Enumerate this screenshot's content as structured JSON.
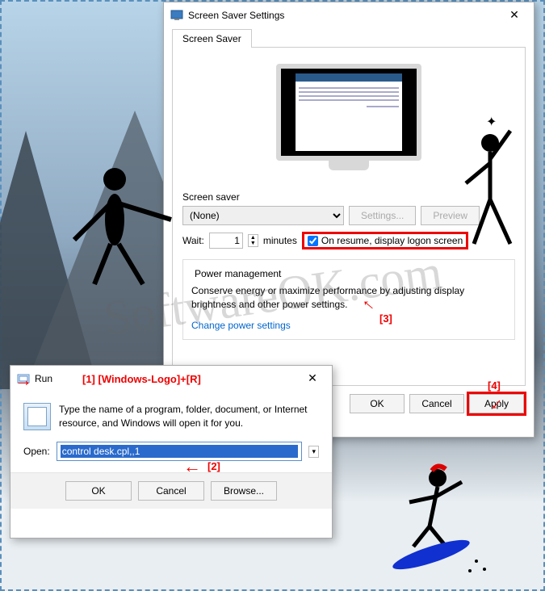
{
  "watermark": "SoftwareOK.com",
  "screensaver_dialog": {
    "title": "Screen Saver Settings",
    "tab": "Screen Saver",
    "group_label": "Screen saver",
    "saver_selected": "(None)",
    "settings_btn": "Settings...",
    "preview_btn": "Preview",
    "wait_label": "Wait:",
    "wait_value": "1",
    "minutes_label": "minutes",
    "resume_label": "On resume, display logon screen",
    "power_legend": "Power management",
    "power_text": "Conserve energy or maximize performance by adjusting display brightness and other power settings.",
    "power_link": "Change power settings",
    "ok": "OK",
    "cancel": "Cancel",
    "apply": "Apply"
  },
  "run_dialog": {
    "title": "Run",
    "description": "Type the name of a program, folder, document, or Internet resource, and Windows will open it for you.",
    "open_label": "Open:",
    "open_value": "control desk.cpl,,1",
    "ok": "OK",
    "cancel": "Cancel",
    "browse": "Browse..."
  },
  "annotations": {
    "a1": "[1] [Windows-Logo]+[R]",
    "a2": "[2]",
    "a3": "[3]",
    "a4": "[4]"
  }
}
